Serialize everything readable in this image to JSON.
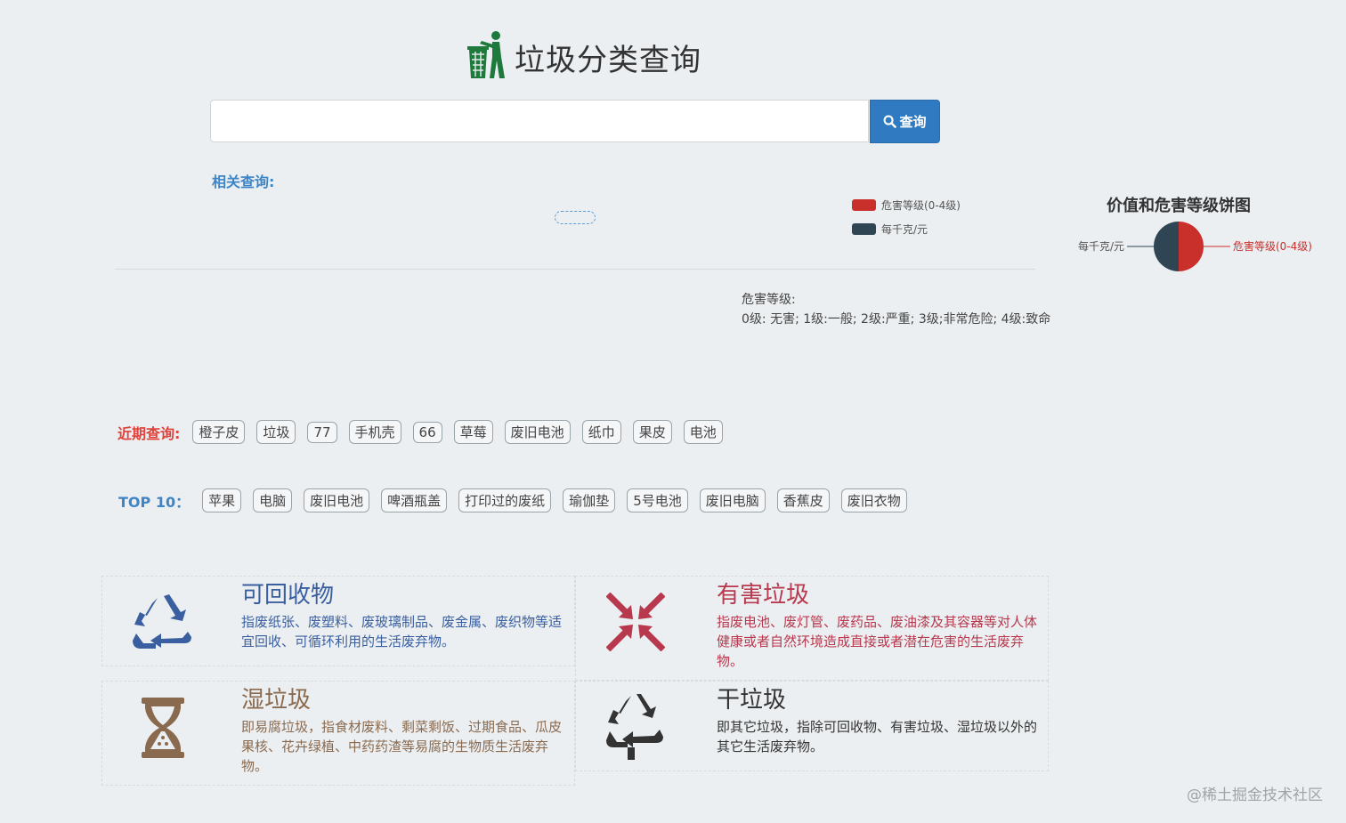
{
  "header": {
    "title": "垃圾分类查询",
    "logo_icon": "trash-bin-person-icon"
  },
  "search": {
    "placeholder": "",
    "value": "",
    "button_label": "查询",
    "button_icon": "search-icon"
  },
  "related": {
    "label": "相关查询:"
  },
  "legend": {
    "items": [
      {
        "label": "危害等级(0-4级)",
        "color": "#c9302c"
      },
      {
        "label": "每千克/元",
        "color": "#2f4554"
      }
    ]
  },
  "chart_data": {
    "type": "pie",
    "title": "价值和危害等级饼图",
    "series": [
      {
        "name": "每千克/元",
        "value": 1,
        "color": "#2f4554"
      },
      {
        "name": "危害等级(0-4级)",
        "value": 1,
        "color": "#c9302c"
      }
    ]
  },
  "hazard_info": {
    "title": "危害等级:",
    "levels": "0级: 无害; 1级:一般; 2级:严重; 3级;非常危险; 4级:致命"
  },
  "recent": {
    "label": "近期查询:",
    "tags": [
      "橙子皮",
      "垃圾",
      "77",
      "手机壳",
      "66",
      "草莓",
      "废旧电池",
      "纸巾",
      "果皮",
      "电池"
    ]
  },
  "top10": {
    "label": "TOP 10：",
    "tags": [
      "苹果",
      "电脑",
      "废旧电池",
      "啤酒瓶盖",
      "打印过的废纸",
      "瑜伽垫",
      "5号电池",
      "废旧电脑",
      "香蕉皮",
      "废旧衣物"
    ]
  },
  "categories": {
    "recyclable": {
      "title": "可回收物",
      "desc": "指废纸张、废塑料、废玻璃制品、废金属、废织物等适宜回收、可循环利用的生活废弃物。",
      "color": "#3a5fa0",
      "icon": "recycle-icon"
    },
    "hazardous": {
      "title": "有害垃圾",
      "desc": "指废电池、废灯管、废药品、废油漆及其容器等对人体健康或者自然环境造成直接或者潜在危害的生活废弃物。",
      "color": "#b8384e",
      "icon": "hazard-arrows-icon"
    },
    "wet": {
      "title": "湿垃圾",
      "desc": "即易腐垃圾，指食材废料、剩菜剩饭、过期食品、瓜皮果核、花卉绿植、中药药渣等易腐的生物质生活废弃物。",
      "color": "#8a6a4f",
      "icon": "hourglass-icon"
    },
    "dry": {
      "title": "干垃圾",
      "desc": "即其它垃圾，指除可回收物、有害垃圾、湿垃圾以外的其它生活废弃物。",
      "color": "#333333",
      "icon": "residual-recycle-icon"
    }
  },
  "watermark": "@稀土掘金技术社区"
}
